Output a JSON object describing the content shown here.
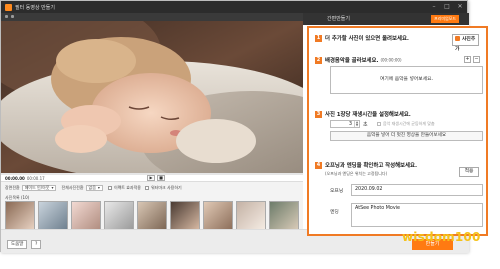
{
  "window": {
    "title": "필터 동영상 만들기"
  },
  "tabs": {
    "easy": "간편만들기",
    "premium": "프리미엄모드"
  },
  "player": {
    "time_label": "00:00.00",
    "time_value": "00:00.17"
  },
  "options": {
    "transition_label": "장면전환",
    "transition_value": "페이드 인/아웃",
    "effect_label": "전체사진전환",
    "effect_value": "없음",
    "check1": "이펙트 효과적용",
    "check2": "워터마크 사용하기"
  },
  "photos": {
    "header": "사진목록 (10)"
  },
  "bottom": {
    "help": "도움말",
    "question": "?",
    "make": "만들기"
  },
  "steps": {
    "s1": {
      "num": "1",
      "title": "더 추가할 사진이 있으면 올려보세요.",
      "button": "사진추가"
    },
    "s2": {
      "num": "2",
      "title": "배경음악을 골라보세요.",
      "sub": "(00:00:00)",
      "placeholder": "여기에 음악을 넣어보세요.",
      "plus": "+",
      "minus": "−"
    },
    "s3": {
      "num": "3",
      "title": "사진 1장당 재생시간을 설정해보세요.",
      "value": "3",
      "unit": "초",
      "auto_label": "음악 재생시간에 균등하게 맞춤",
      "fit_button": "음악을 넣어 더 멋진 영상을 만들어보세요"
    },
    "s4": {
      "num": "4",
      "title": "오프닝과 엔딩을 확인하고 작성해보세요.",
      "sub": "(오프닝과 엔딩은 위치는 고정됩니다)",
      "apply": "적용",
      "opening_label": "오프닝",
      "opening_value": "2020.09.02",
      "ending_label": "엔딩",
      "ending_value": "AtSee Photo Movie"
    }
  },
  "watermark": "wisdom100"
}
